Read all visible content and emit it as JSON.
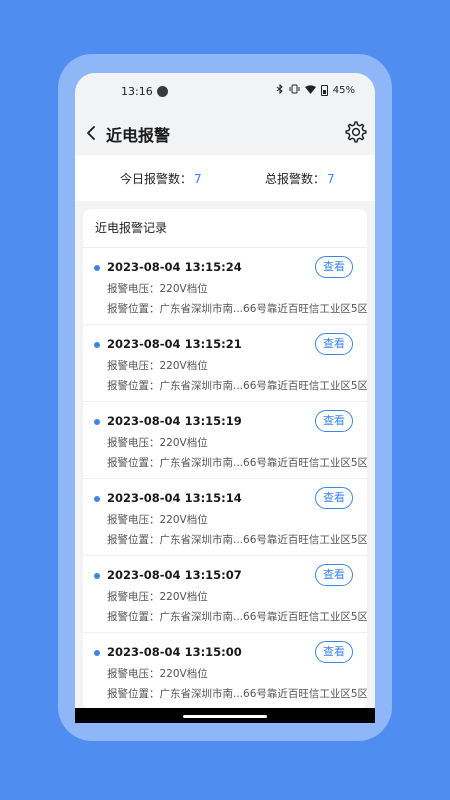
{
  "status_bar": {
    "time": "13:16",
    "battery": "45%",
    "icons": [
      "bluetooth-icon",
      "vibrate-icon",
      "wifi-icon",
      "battery-icon"
    ]
  },
  "header": {
    "title": "近电报警",
    "back_icon": "chevron-left-icon",
    "settings_icon": "gear-icon"
  },
  "stats": {
    "today_label": "今日报警数：",
    "today_value": "7",
    "total_label": "总报警数：",
    "total_value": "7"
  },
  "records": {
    "title": "近电报警记录",
    "view_label": "查看",
    "items": [
      {
        "time": "2023-08-04 13:15:24",
        "voltage": "报警电压：220V档位",
        "location": "报警位置：广东省深圳市南...66号靠近百旺信工业区5区"
      },
      {
        "time": "2023-08-04 13:15:21",
        "voltage": "报警电压：220V档位",
        "location": "报警位置：广东省深圳市南...66号靠近百旺信工业区5区"
      },
      {
        "time": "2023-08-04 13:15:19",
        "voltage": "报警电压：220V档位",
        "location": "报警位置：广东省深圳市南...66号靠近百旺信工业区5区"
      },
      {
        "time": "2023-08-04 13:15:14",
        "voltage": "报警电压：220V档位",
        "location": "报警位置：广东省深圳市南...66号靠近百旺信工业区5区"
      },
      {
        "time": "2023-08-04 13:15:07",
        "voltage": "报警电压：220V档位",
        "location": "报警位置：广东省深圳市南...66号靠近百旺信工业区5区"
      },
      {
        "time": "2023-08-04 13:15:00",
        "voltage": "报警电压：220V档位",
        "location": "报警位置：广东省深圳市南...66号靠近百旺信工业区5区"
      }
    ]
  },
  "colors": {
    "background": "#4f8ef0",
    "accent": "#3a86e6"
  }
}
